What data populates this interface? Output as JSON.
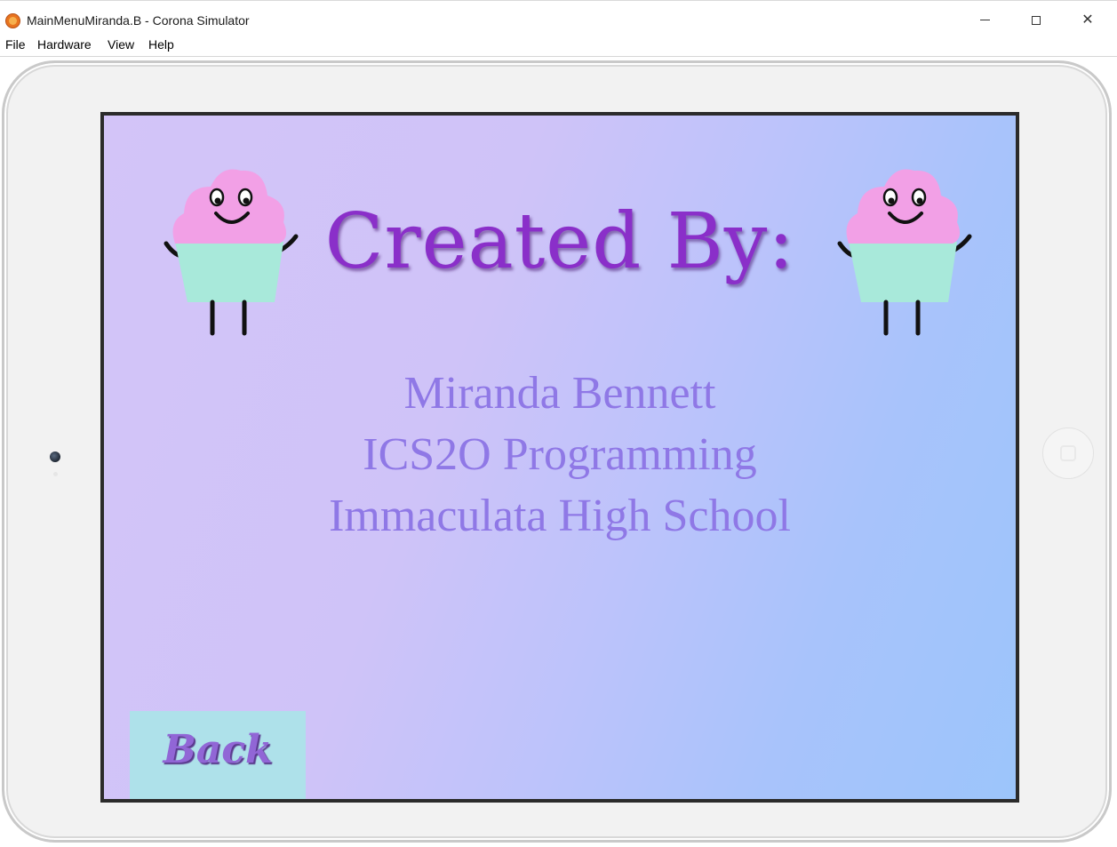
{
  "window": {
    "title": "MainMenuMiranda.B - Corona Simulator",
    "app_icon": "corona-logo-icon",
    "controls": [
      "minimize",
      "maximize",
      "close"
    ]
  },
  "menu": {
    "items": [
      {
        "label": "File"
      },
      {
        "label": "Hardware"
      },
      {
        "label": "View"
      },
      {
        "label": "Help"
      }
    ]
  },
  "screen": {
    "heading": "Created By:",
    "credits": [
      "Miranda Bennett",
      "ICS2O Programming",
      "Immaculata High School"
    ],
    "back_button": "Back",
    "decorations": [
      "cupcake-character",
      "cupcake-character"
    ]
  },
  "colors": {
    "heading": "#8a2fc9",
    "credits": "#8f78e6",
    "back_button_bg": "#aee1ea",
    "back_label": "#9166d6",
    "frosting": "#f2a0e6",
    "cup": "#a8e9da"
  }
}
